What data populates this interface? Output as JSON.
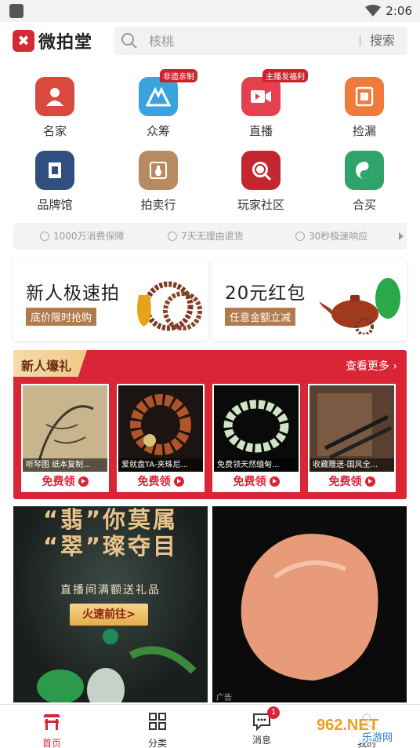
{
  "status_bar": {
    "time": "2:06"
  },
  "header": {
    "logo_mark": "✖",
    "logo_text": "微拍堂",
    "search_placeholder": "核桃",
    "search_button": "搜索"
  },
  "categories": [
    {
      "label": "名家",
      "color": "#d94a3e",
      "badge": ""
    },
    {
      "label": "众筹",
      "color": "#3aa2dd",
      "badge": "非遗亲制"
    },
    {
      "label": "直播",
      "color": "#e4404f",
      "badge": "主播发福利"
    },
    {
      "label": "捡漏",
      "color": "#ef7a3a",
      "badge": ""
    },
    {
      "label": "品牌馆",
      "color": "#2f4f7f",
      "badge": ""
    },
    {
      "label": "拍卖行",
      "color": "#b88a62",
      "badge": ""
    },
    {
      "label": "玩家社区",
      "color": "#c3262f",
      "badge": ""
    },
    {
      "label": "合买",
      "color": "#2ea36a",
      "badge": ""
    }
  ],
  "guarantees": [
    "1000万消费保障",
    "7天无理由退货",
    "30秒极速响应"
  ],
  "promos": [
    {
      "title": "新人极速拍",
      "subtitle": "底价限时抢购"
    },
    {
      "title": "20元红包",
      "subtitle": "任意金额立减"
    }
  ],
  "gift": {
    "title": "新人壕礼",
    "more": "查看更多",
    "items": [
      {
        "caption": "听琴图 纸本复制...",
        "button": "免费领"
      },
      {
        "caption": "爱就盘TA-夹珠尼...",
        "button": "免费领"
      },
      {
        "caption": "免费领天然缅甸...",
        "button": "免费领"
      },
      {
        "caption": "收藏赠送-国风全...",
        "button": "免费领"
      }
    ]
  },
  "banner": {
    "line1": "“翡”你莫属",
    "line2": "“翠”璨夺目",
    "sub": "直播间满额送礼品",
    "button": "火速前往>",
    "ad_label": "广告"
  },
  "nav": {
    "items": [
      {
        "label": "首页",
        "active": true
      },
      {
        "label": "分类",
        "active": false
      },
      {
        "label": "消息",
        "active": false,
        "badge": "1"
      },
      {
        "label": "我的",
        "active": false
      }
    ]
  },
  "watermark": {
    "main": "962.NET",
    "sub": "乐游网"
  },
  "colors": {
    "brand_red": "#d92536",
    "gold": "#e9c38a"
  }
}
